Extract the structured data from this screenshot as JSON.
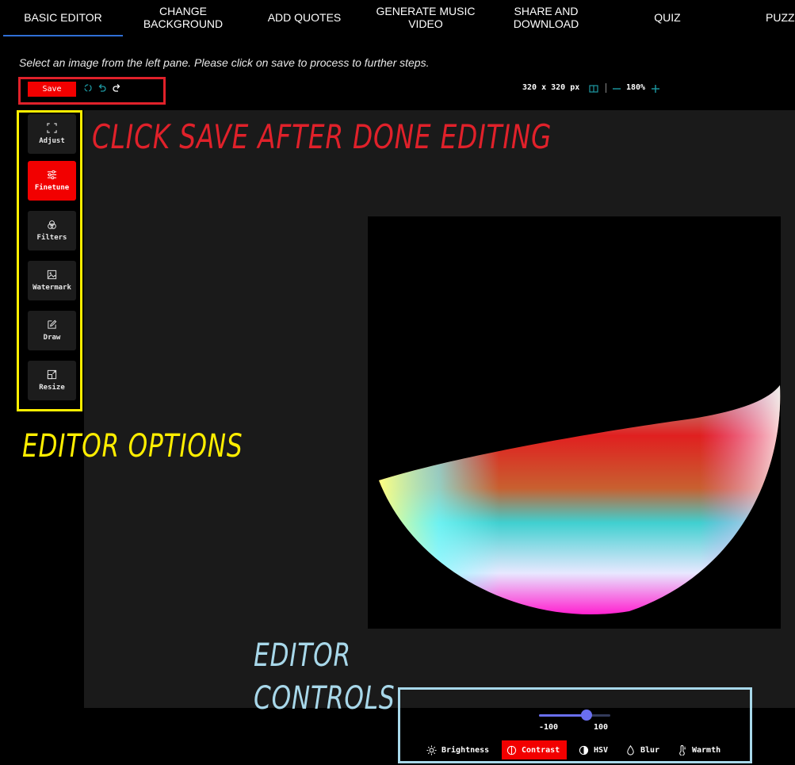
{
  "nav": {
    "tabs": [
      {
        "label": "BASIC EDITOR"
      },
      {
        "label": "CHANGE\nBACKGROUND"
      },
      {
        "label": "ADD QUOTES"
      },
      {
        "label": "GENERATE MUSIC\nVIDEO"
      },
      {
        "label": "SHARE AND\nDOWNLOAD"
      },
      {
        "label": "QUIZ"
      },
      {
        "label": "PUZZ"
      }
    ],
    "active_color": "#2f6fd6"
  },
  "hint": "Select an image from the left pane. Please click on save to process to further steps.",
  "toolbar": {
    "save_label": "Save",
    "size_info": "320 x 320 px",
    "zoom": "180%",
    "icons": [
      "reset-icon",
      "undo-icon",
      "redo-icon",
      "compare-icon",
      "zoom-out-icon",
      "zoom-in-icon"
    ]
  },
  "tools": [
    {
      "label": "Adjust",
      "icon": "crop-icon",
      "active": false
    },
    {
      "label": "Finetune",
      "icon": "sliders-icon",
      "active": true
    },
    {
      "label": "Filters",
      "icon": "filters-icon",
      "active": false
    },
    {
      "label": "Watermark",
      "icon": "image-icon",
      "active": false
    },
    {
      "label": "Draw",
      "icon": "pencil-icon",
      "active": false
    },
    {
      "label": "Resize",
      "icon": "resize-icon",
      "active": false
    }
  ],
  "annotations": {
    "save_note": "CLICK SAVE AFTER DONE EDITING",
    "options_note": "EDITOR OPTIONS",
    "controls_note_1": "EDITOR",
    "controls_note_2": "CONTROLS",
    "save_color": "#e0212a",
    "options_color": "#ffee00",
    "controls_color": "#a8d8ea"
  },
  "finetune": {
    "min_label": "-100",
    "max_label": "100",
    "slider_fraction": 0.67,
    "controls": [
      {
        "label": "Brightness",
        "icon": "sun-icon",
        "active": false
      },
      {
        "label": "Contrast",
        "icon": "contrast-icon",
        "active": true
      },
      {
        "label": "HSV",
        "icon": "half-circle-icon",
        "active": false
      },
      {
        "label": "Blur",
        "icon": "drop-icon",
        "active": false
      },
      {
        "label": "Warmth",
        "icon": "thermometer-icon",
        "active": false
      }
    ]
  },
  "accent": "#f20000"
}
